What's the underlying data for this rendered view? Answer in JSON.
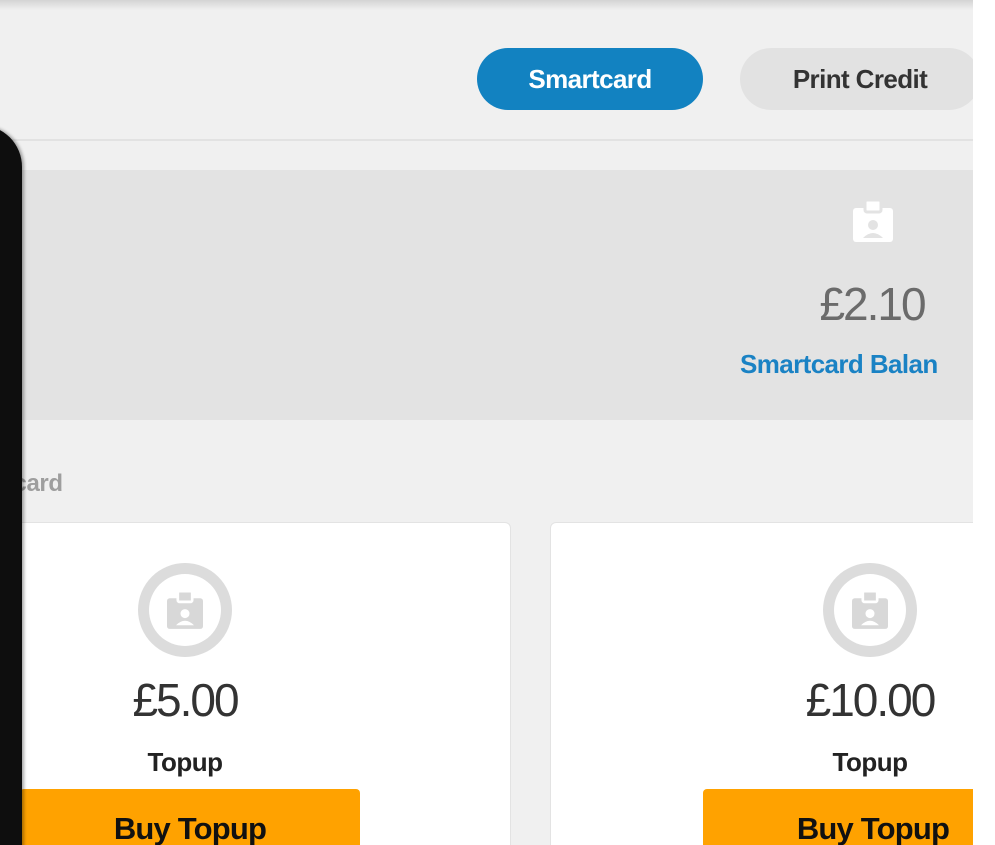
{
  "tabs": [
    {
      "label": "Smartcard",
      "active": true
    },
    {
      "label": "Print Credit",
      "active": false
    }
  ],
  "balance": {
    "icon": "id-badge-icon",
    "amount": "£2.10",
    "label": "Smartcard Balan"
  },
  "section": {
    "title": "rtcard"
  },
  "products": [
    {
      "icon": "id-badge-icon",
      "price": "£5.00",
      "name": "Topup",
      "button": "Buy Topup"
    },
    {
      "icon": "id-badge-icon",
      "price": "£10.00",
      "name": "Topup",
      "button": "Buy Topup"
    }
  ],
  "colors": {
    "accent": "#1282c1",
    "balance_label": "#1a82c4",
    "buy_button": "#ffa200",
    "panel": "#e3e3e3",
    "background": "#f0f0f0"
  }
}
